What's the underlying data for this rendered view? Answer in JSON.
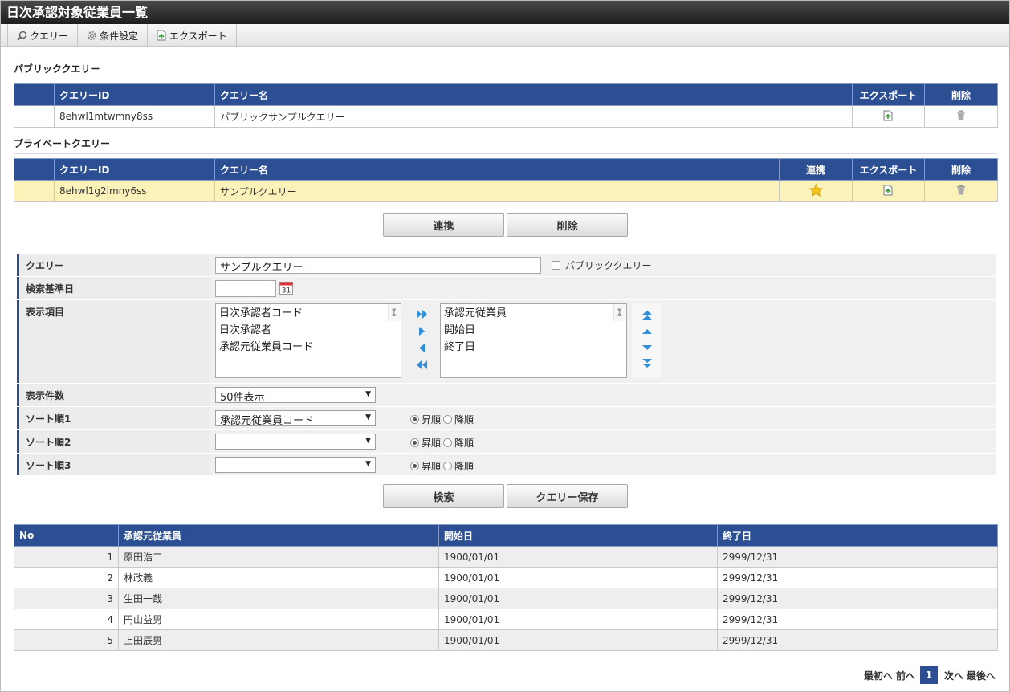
{
  "window": {
    "title": "日次承認対象従業員一覧"
  },
  "toolbar": {
    "query": "クエリー",
    "conditions": "条件設定",
    "export": "エクスポート"
  },
  "public_section": {
    "title": "パブリッククエリー",
    "headers": {
      "id": "クエリーID",
      "name": "クエリー名",
      "export": "エクスポート",
      "delete": "削除"
    },
    "rows": [
      {
        "id": "8ehwl1mtwmny8ss",
        "name": "パブリックサンプルクエリー"
      }
    ]
  },
  "private_section": {
    "title": "プライベートクエリー",
    "headers": {
      "id": "クエリーID",
      "name": "クエリー名",
      "link": "連携",
      "export": "エクスポート",
      "delete": "削除"
    },
    "rows": [
      {
        "id": "8ehwl1g2imny6ss",
        "name": "サンプルクエリー"
      }
    ]
  },
  "actions": {
    "link": "連携",
    "delete": "削除",
    "search": "検索",
    "save": "クエリー保存"
  },
  "form": {
    "query_label": "クエリー",
    "query_value": "サンプルクエリー",
    "public_checkbox": "パブリッククエリー",
    "date_label": "検索基準日",
    "date_value": "",
    "calendar_day": "31",
    "columns_label": "表示項目",
    "available_items": [
      "日次承認者コード",
      "日次承認者",
      "承認元従業員コード"
    ],
    "selected_items": [
      "承認元従業員",
      "開始日",
      "終了日"
    ],
    "count_label": "表示件数",
    "count_value": "50件表示",
    "sort1_label": "ソート順1",
    "sort1_value": "承認元従業員コード",
    "sort2_label": "ソート順2",
    "sort2_value": "",
    "sort3_label": "ソート順3",
    "sort3_value": "",
    "asc": "昇順",
    "desc": "降順"
  },
  "results": {
    "headers": {
      "no": "No",
      "employee": "承認元従業員",
      "start": "開始日",
      "end": "終了日"
    },
    "rows": [
      {
        "no": "1",
        "employee": "原田浩二",
        "start": "1900/01/01",
        "end": "2999/12/31"
      },
      {
        "no": "2",
        "employee": "林政義",
        "start": "1900/01/01",
        "end": "2999/12/31"
      },
      {
        "no": "3",
        "employee": "生田一哉",
        "start": "1900/01/01",
        "end": "2999/12/31"
      },
      {
        "no": "4",
        "employee": "円山益男",
        "start": "1900/01/01",
        "end": "2999/12/31"
      },
      {
        "no": "5",
        "employee": "上田辰男",
        "start": "1900/01/01",
        "end": "2999/12/31"
      }
    ]
  },
  "pager": {
    "first": "最初へ",
    "prev": "前へ",
    "current": "1",
    "next": "次へ",
    "last": "最後へ"
  },
  "colors": {
    "header_blue": "#2c4f94",
    "selected_row": "#fbf2ba",
    "star": "#f5c518"
  }
}
